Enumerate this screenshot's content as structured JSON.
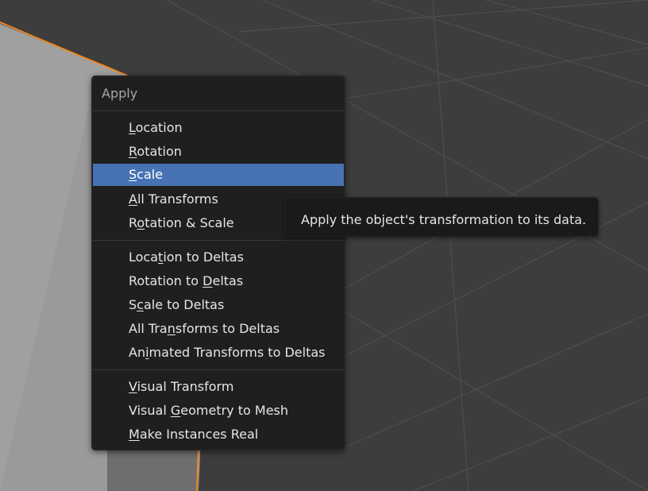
{
  "viewport": {
    "background": "#3d3d3d",
    "object_color": "#999999",
    "selection_outline": "#f08a20"
  },
  "menu": {
    "title": "Apply",
    "items": [
      {
        "pre": "",
        "key": "L",
        "post": "ocation",
        "active": false
      },
      {
        "pre": "",
        "key": "R",
        "post": "otation",
        "active": false
      },
      {
        "pre": "",
        "key": "S",
        "post": "cale",
        "active": true
      },
      {
        "pre": "",
        "key": "A",
        "post": "ll Transforms",
        "active": false
      },
      {
        "pre": "R",
        "key": "o",
        "post": "tation & Scale",
        "active": false
      },
      {
        "pre": "Loca",
        "key": "t",
        "post": "ion to Deltas",
        "active": false
      },
      {
        "pre": "Rotation to ",
        "key": "D",
        "post": "eltas",
        "active": false
      },
      {
        "pre": "S",
        "key": "c",
        "post": "ale to Deltas",
        "active": false
      },
      {
        "pre": "All Tra",
        "key": "n",
        "post": "sforms to Deltas",
        "active": false
      },
      {
        "pre": "An",
        "key": "i",
        "post": "mated Transforms to Deltas",
        "active": false
      },
      {
        "pre": "",
        "key": "V",
        "post": "isual Transform",
        "active": false
      },
      {
        "pre": "Visual ",
        "key": "G",
        "post": "eometry to Mesh",
        "active": false
      },
      {
        "pre": "",
        "key": "M",
        "post": "ake Instances Real",
        "active": false
      }
    ],
    "highlight_color": "#4772b3"
  },
  "tooltip": {
    "text": "Apply the object's transformation to its data."
  }
}
